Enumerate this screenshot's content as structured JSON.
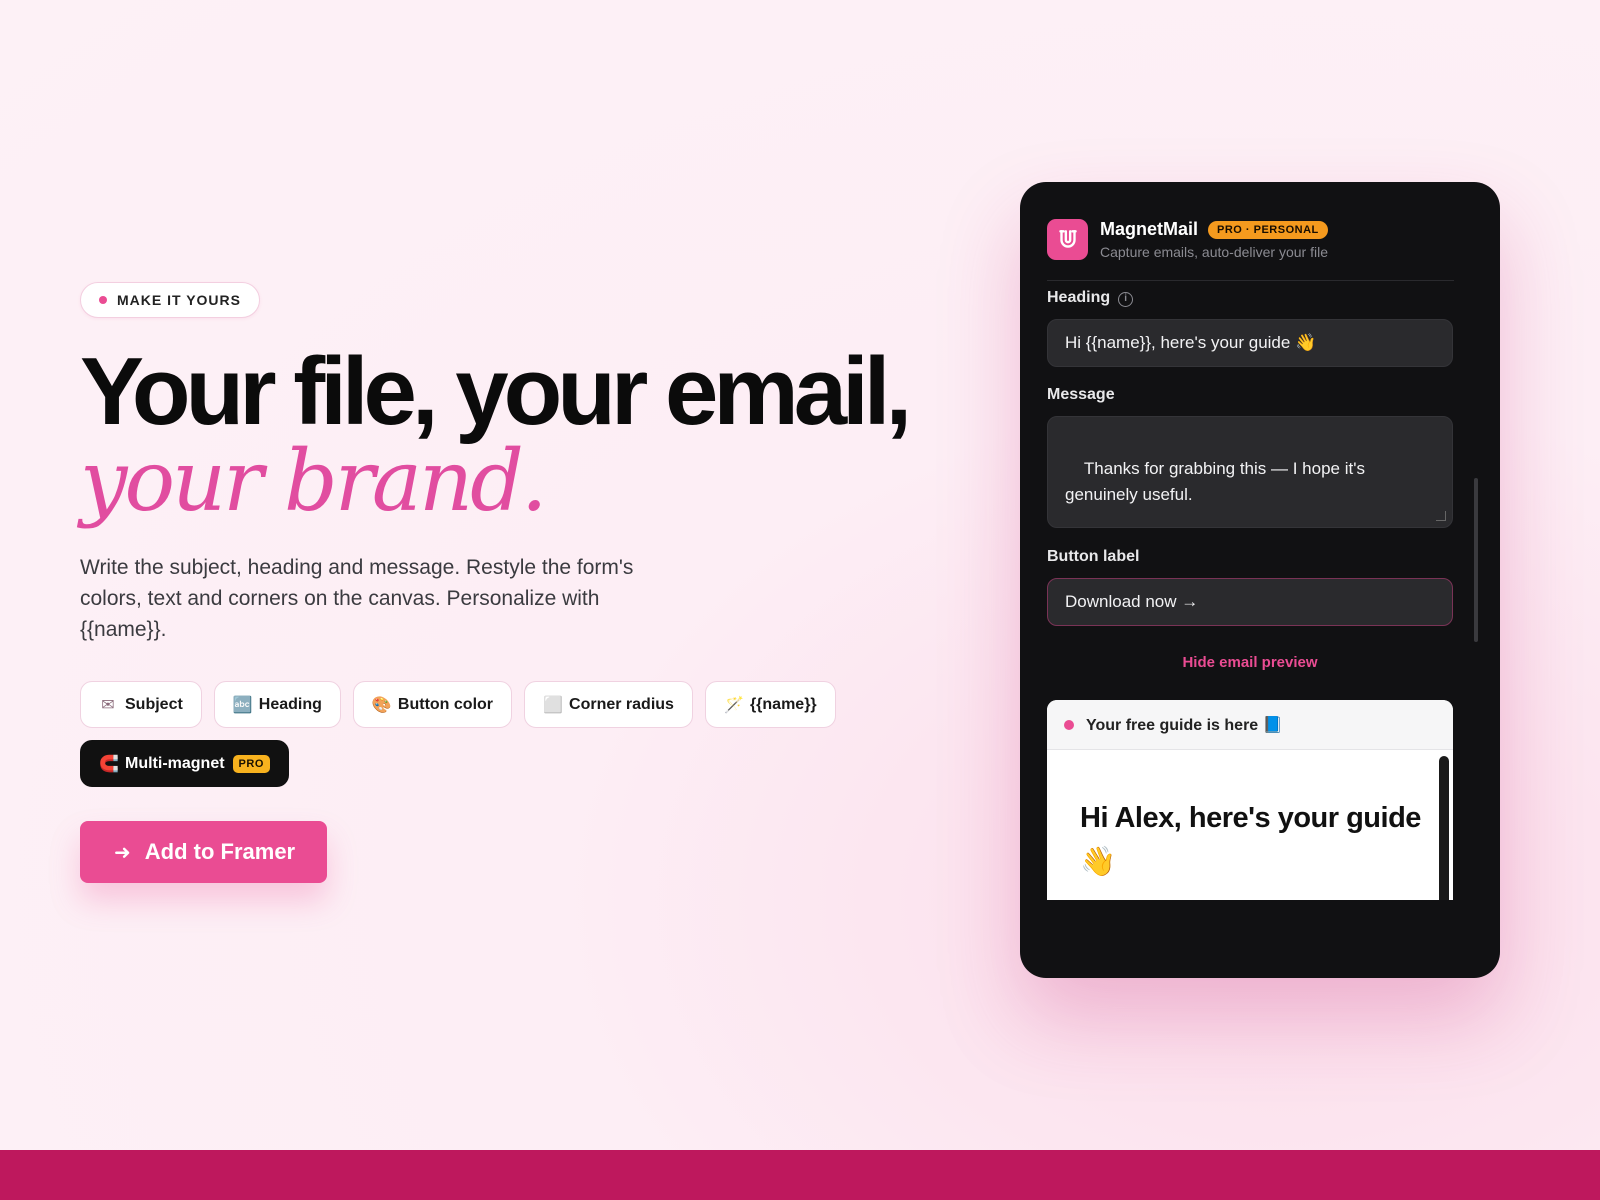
{
  "hero": {
    "eyebrow": "MAKE IT YOURS",
    "title_line1": "Your file, your email,",
    "title_line2": "your brand.",
    "description": "Write the subject, heading and message. Restyle the form's colors, text and corners on the canvas. Personalize with {{name}}.",
    "chips": [
      {
        "icon": "✉",
        "icon_name": "envelope-icon",
        "label": "Subject"
      },
      {
        "icon": "🔤",
        "icon_name": "abc-icon",
        "label": "Heading"
      },
      {
        "icon": "🎨",
        "icon_name": "palette-icon",
        "label": "Button color"
      },
      {
        "icon": "⬜",
        "icon_name": "square-icon",
        "label": "Corner radius"
      },
      {
        "icon": "🪄",
        "icon_name": "wand-icon",
        "label": "{{name}}"
      }
    ],
    "pro_chip": {
      "icon": "🧲",
      "label": "Multi-magnet",
      "tag": "PRO"
    },
    "cta": {
      "arrow": "➜",
      "label": "Add to Framer"
    }
  },
  "panel": {
    "app_name": "MagnetMail",
    "plan_badge": "PRO · PERSONAL",
    "tagline": "Capture emails, auto-deliver your file",
    "heading_label": "Heading",
    "heading_info": "i",
    "heading_value": "Hi {{name}}, here's your guide 👋",
    "message_label": "Message",
    "message_value": "Thanks for grabbing this — I hope it's genuinely useful.\n\nClick the button below to download. The",
    "button_label_label": "Button label",
    "button_label_value": "Download now →",
    "hide_preview": "Hide email preview",
    "preview": {
      "subject": "Your free guide is here 📘",
      "heading": "Hi Alex, here's your guide 👋"
    }
  },
  "colors": {
    "accent": "#ea4c93",
    "footer": "#be185d",
    "panel_bg": "#111113"
  }
}
